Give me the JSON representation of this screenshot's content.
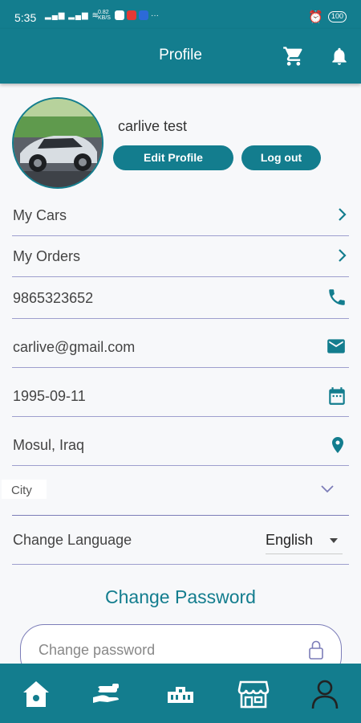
{
  "status_bar": {
    "time": "5:35",
    "network_speed": "0.82 KB/S",
    "battery": "100"
  },
  "header": {
    "title": "Profile"
  },
  "profile": {
    "name": "carlive test",
    "edit_label": "Edit Profile",
    "logout_label": "Log out"
  },
  "rows": {
    "my_cars": "My Cars",
    "my_orders": "My Orders",
    "phone": "9865323652",
    "email": "carlive@gmail.com",
    "birthdate": "1995-09-11",
    "location": "Mosul, Iraq",
    "city_label": "City",
    "change_language_label": "Change Language",
    "language_value": "English"
  },
  "password": {
    "title": "Change Password",
    "placeholder": "Change password"
  },
  "colors": {
    "primary": "#137d8e",
    "divider": "#9e9fce"
  },
  "bottom_nav": [
    "home-icon",
    "car-keys-icon",
    "dealership-icon",
    "store-icon",
    "person-icon"
  ]
}
